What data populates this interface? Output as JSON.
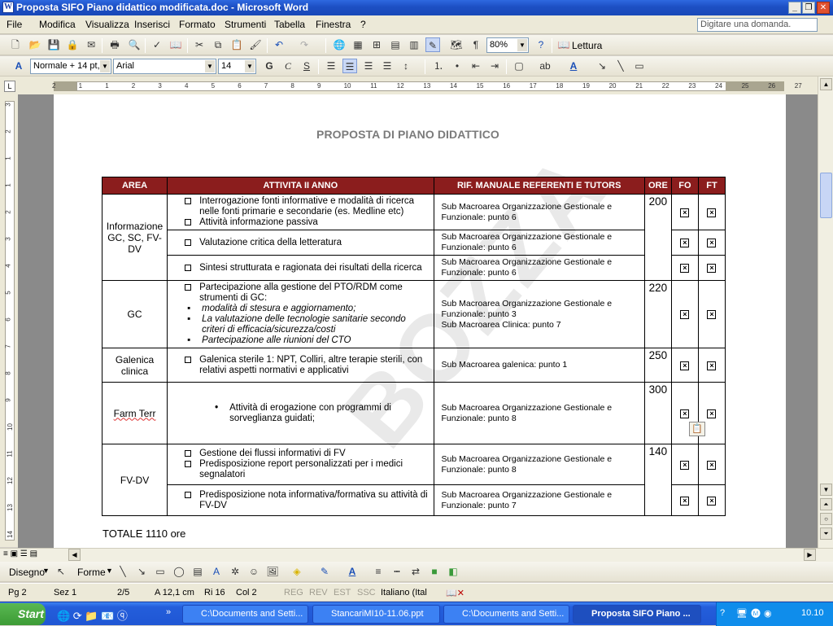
{
  "window": {
    "title": "Proposta SIFO Piano didattico modificata.doc - Microsoft Word",
    "icon": "word-doc-icon"
  },
  "menubar": {
    "items": [
      "File",
      "Modifica",
      "Visualizza",
      "Inserisci",
      "Formato",
      "Strumenti",
      "Tabella",
      "Finestra",
      "?"
    ],
    "ask_placeholder": "Digitare una domanda."
  },
  "toolbar_standard": {
    "zoom": "80%",
    "read_label": "Lettura"
  },
  "toolbar_format": {
    "style": "Normale + 14 pt,",
    "font": "Arial",
    "size": "14",
    "bold": "G",
    "italic": "C",
    "strike": "S"
  },
  "ruler": {
    "h_ticks": [
      "2",
      "1",
      "1",
      "2",
      "3",
      "4",
      "5",
      "6",
      "7",
      "8",
      "9",
      "10",
      "11",
      "12",
      "13",
      "14",
      "15",
      "16",
      "17",
      "18",
      "19",
      "20",
      "21",
      "22",
      "23",
      "24",
      "25",
      "26",
      "27"
    ],
    "v_ticks": [
      "3",
      "2",
      "1",
      "1",
      "2",
      "3",
      "4",
      "5",
      "6",
      "7",
      "8",
      "9",
      "10",
      "11",
      "12",
      "13",
      "14"
    ]
  },
  "document": {
    "title": "PROPOSTA DI PIANO DIDATTICO",
    "watermark": "BOZZA",
    "headers": {
      "area": "AREA",
      "attivita": "ATTIVITA II ANNO",
      "rif": "RIF. MANUALE REFERENTI E TUTORS",
      "ore": "ORE",
      "fo": "FO",
      "ft": "FT"
    },
    "rows": [
      {
        "area": "Informazione GC, SC, FV-DV",
        "ore": "200",
        "act1a": "Interrogazione fonti informative e modalità di ricerca nelle fonti primarie e secondarie (es. Medline etc)",
        "act1b": "Attività informazione passiva",
        "rif1": "Sub Macroarea Organizzazione Gestionale e Funzionale: punto 6",
        "act2": "Valutazione critica della letteratura",
        "rif2": "Sub Macroarea Organizzazione Gestionale e Funzionale: punto 6",
        "act3": "Sintesi strutturata e ragionata dei risultati della ricerca",
        "rif3": "Sub Macroarea Organizzazione Gestionale e Funzionale: punto 6"
      },
      {
        "area": "GC",
        "ore": "220",
        "act": "Partecipazione alla gestione del PTO/RDM come strumenti di GC:",
        "b1": "modalità di stesura e aggiornamento;",
        "b2": "La valutazione delle tecnologie sanitarie secondo criteri di efficacia/sicurezza/costi",
        "b3": "Partecipazione alle riunioni del CTO",
        "rif_a": "Sub Macroarea Organizzazione Gestionale e Funzionale: punto 3",
        "rif_b": "Sub Macroarea Clinica: punto 7"
      },
      {
        "area": "Galenica clinica",
        "ore": "250",
        "act": "Galenica sterile 1: NPT, Colliri, altre terapie sterili, con relativi aspetti normativi e applicativi",
        "rif": "Sub Macroarea galenica: punto 1"
      },
      {
        "area": "Farm Terr",
        "ore": "300",
        "act": "Attività di erogazione con programmi di sorveglianza guidati;",
        "rif": "Sub Macroarea Organizzazione Gestionale e Funzionale: punto 8"
      },
      {
        "area": "FV-DV",
        "ore": "140",
        "act1a": "Gestione dei flussi informativi di FV",
        "act1b": "Predisposizione report personalizzati per i medici segnalatori",
        "rif1": "Sub Macroarea Organizzazione Gestionale e Funzionale: punto 8",
        "act2": "Predisposizione nota informativa/formativa su attività di FV-DV",
        "rif2": "Sub Macroarea Organizzazione Gestionale e Funzionale: punto 7"
      }
    ],
    "check_mark": "×",
    "totale": "TOTALE 1110 ore"
  },
  "drawbar": {
    "draw": "Disegno",
    "shapes": "Forme"
  },
  "status": {
    "page": "Pg 2",
    "sec": "Sez 1",
    "pages": "2/5",
    "at": "A 12,1 cm",
    "line": "Ri 16",
    "col": "Col 2",
    "rec": "REG",
    "rev": "REV",
    "ext": "EST",
    "ovr": "SSC",
    "lang": "Italiano (Ital"
  },
  "taskbar": {
    "start": "Start",
    "tasks": [
      "C:\\Documents and Setti...",
      "StancariMI10-11.06.ppt",
      "C:\\Documents and Setti...",
      "Proposta SIFO Piano ..."
    ],
    "clock": "10.10"
  }
}
